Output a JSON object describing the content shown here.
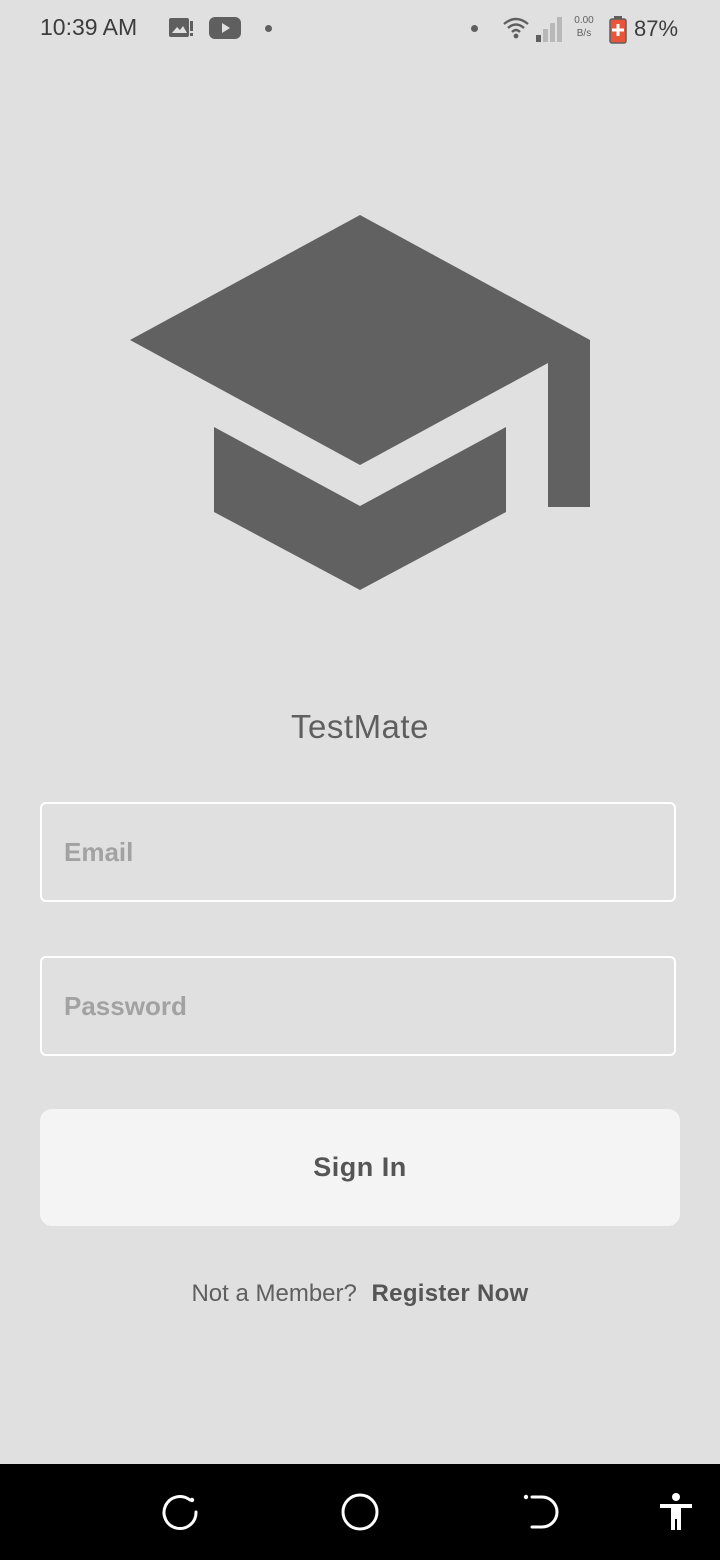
{
  "status_bar": {
    "time": "10:39 AM",
    "net_speed_value": "0.00",
    "net_speed_unit": "B/s",
    "battery_percent": "87%",
    "icons": [
      "gallery-notification-icon",
      "youtube-icon",
      "notification-dot-icon",
      "wifi-icon",
      "signal-icon",
      "battery-icon"
    ]
  },
  "app": {
    "name": "TestMate",
    "logo_icon": "graduation-cap-icon",
    "logo_color": "#616161"
  },
  "login": {
    "email_placeholder": "Email",
    "email_value": "",
    "password_placeholder": "Password",
    "password_value": "",
    "sign_in_label": "Sign In",
    "not_member_text": "Not a Member?",
    "register_label": "Register Now"
  },
  "nav_bar": {
    "buttons": [
      "recent-apps-icon",
      "home-icon",
      "back-icon",
      "accessibility-icon"
    ]
  }
}
